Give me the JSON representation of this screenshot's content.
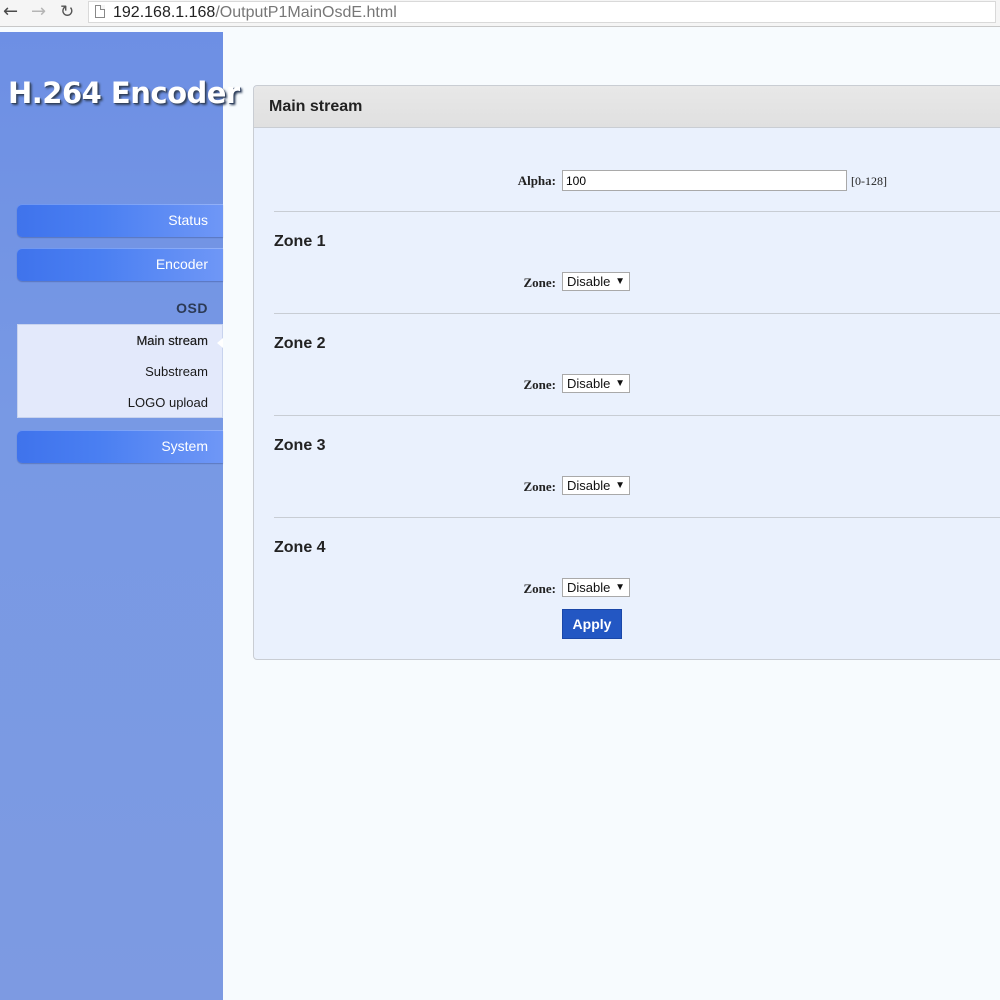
{
  "browser": {
    "url_host": "192.168.1.168",
    "url_path": "/OutputP1MainOsdE.html"
  },
  "sidebar": {
    "logo": "H.264 Encoder",
    "status_label": "Status",
    "encoder_label": "Encoder",
    "osd_label": "OSD",
    "osd_items": [
      {
        "label": "Main stream",
        "active": true
      },
      {
        "label": "Substream",
        "active": false
      },
      {
        "label": "LOGO upload",
        "active": false
      }
    ],
    "system_label": "System"
  },
  "main": {
    "title": "Main stream",
    "alpha": {
      "label": "Alpha:",
      "value": "100",
      "range": "[0-128]"
    },
    "zones": [
      {
        "title": "Zone 1",
        "label": "Zone:",
        "value": "Disable"
      },
      {
        "title": "Zone 2",
        "label": "Zone:",
        "value": "Disable"
      },
      {
        "title": "Zone 3",
        "label": "Zone:",
        "value": "Disable"
      },
      {
        "title": "Zone 4",
        "label": "Zone:",
        "value": "Disable"
      }
    ],
    "apply_label": "Apply"
  },
  "colors": {
    "sidebar_bg": "#7899e4",
    "menu_button": "#4a7ff2",
    "panel_bg": "#eaf1fd",
    "apply_button": "#2357c3"
  }
}
